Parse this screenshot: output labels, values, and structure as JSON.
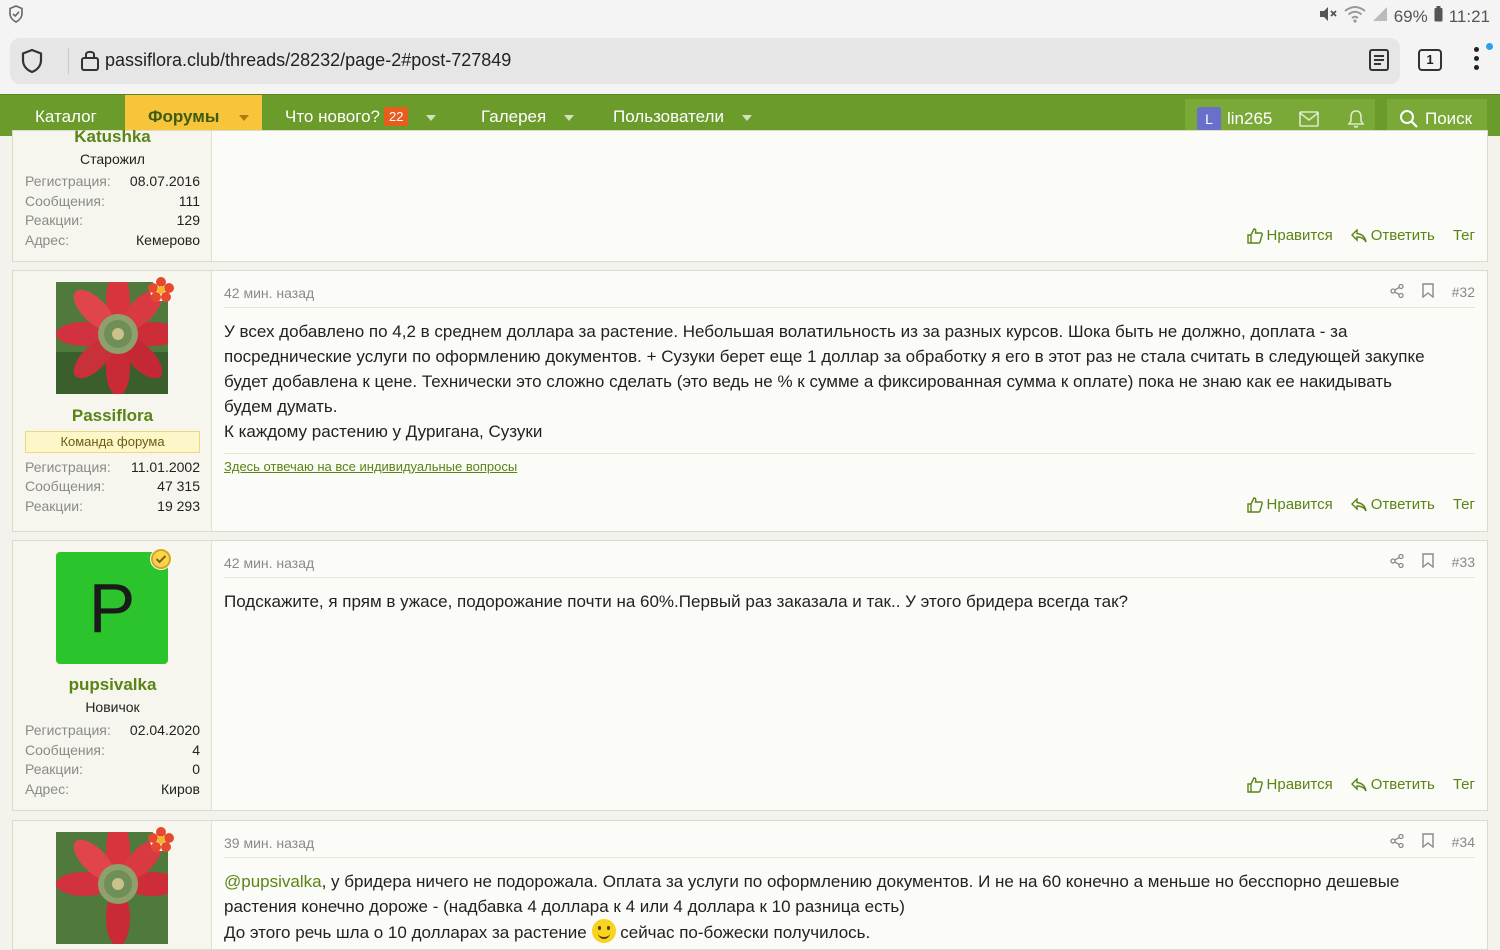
{
  "statusbar": {
    "battery": "69%",
    "time": "11:21"
  },
  "browser": {
    "url": "passiflora.club/threads/28232/page-2#post-727849",
    "tab_count": "1"
  },
  "nav": {
    "catalog": "Каталог",
    "forums": "Форумы",
    "whats_new": "Что нового?",
    "whats_new_badge": "22",
    "gallery": "Галерея",
    "users": "Пользователи",
    "user_initial": "L",
    "username": "lin265",
    "search": "Поиск"
  },
  "actions": {
    "like": "Нравится",
    "reply": "Ответить",
    "tag": "Тег"
  },
  "posts": [
    {
      "username": "Katushka",
      "user_title": "Старожил",
      "stats": [
        {
          "k": "Регистрация:",
          "v": "08.07.2016"
        },
        {
          "k": "Сообщения:",
          "v": "111"
        },
        {
          "k": "Реакции:",
          "v": "129"
        },
        {
          "k": "Адрес:",
          "v": "Кемерово"
        }
      ]
    },
    {
      "time": "42 мин. назад",
      "number": "#32",
      "username": "Passiflora",
      "staff": "Команда форума",
      "stats": [
        {
          "k": "Регистрация:",
          "v": "11.01.2002"
        },
        {
          "k": "Сообщения:",
          "v": "47 315"
        },
        {
          "k": "Реакции:",
          "v": "19 293"
        }
      ],
      "body1": "У всех добавлено по 4,2 в среднем доллара за растение. Небольшая волатильность из за разных курсов. Шока быть не должно, доплата - за посреднические услуги по оформлению документов. + Сузуки берет еще 1 доллар за обработку я его в этот раз не стала считать в следующей закупке будет добавлена к цене. Технически это сложно сделать (это ведь не % к сумме а фиксированная сумма к оплате) пока не знаю как ее накидывать будем думать.",
      "body2": "К каждому растению у Дуригана, Сузуки",
      "signature": "Здесь отвечаю на все индивидуальные вопросы"
    },
    {
      "time": "42 мин. назад",
      "number": "#33",
      "username": "pupsivalka",
      "avatar_letter": "P",
      "user_title": "Новичок",
      "stats": [
        {
          "k": "Регистрация:",
          "v": "02.04.2020"
        },
        {
          "k": "Сообщения:",
          "v": "4"
        },
        {
          "k": "Реакции:",
          "v": "0"
        },
        {
          "k": "Адрес:",
          "v": "Киров"
        }
      ],
      "body": "Подскажите, я прям в ужасе, подорожание почти на 60%.Первый раз заказала и так.. У этого бридера всегда так?"
    },
    {
      "time": "39 мин. назад",
      "number": "#34",
      "mention": "@pupsivalka",
      "body1": ", у бридера ничего не подорожала. Оплата за услуги по оформлению документов. И не на 60 конечно а меньше но бесспорно дешевые растения конечно дороже - (надбавка 4 доллара к 4 или 4 доллара к 10 разница есть)",
      "body2a": "До этого речь шла о 10 долларах за растение",
      "body2b": "сейчас по-божески получилось."
    }
  ]
}
